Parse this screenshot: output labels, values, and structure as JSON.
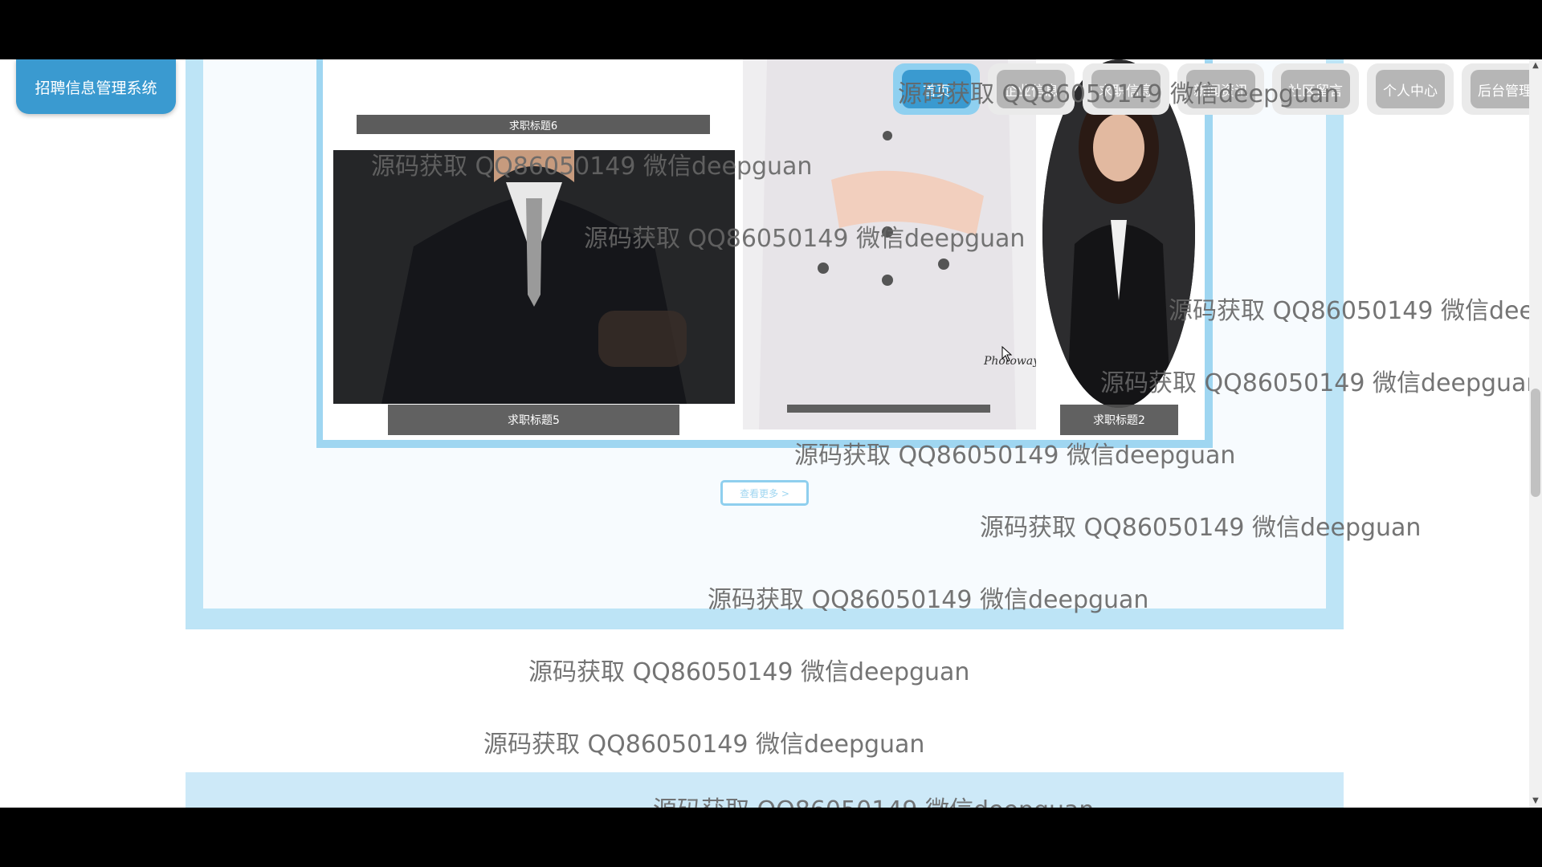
{
  "brand": {
    "title": "招聘信息管理系统"
  },
  "nav": {
    "items": [
      {
        "label": "首页",
        "active": true
      },
      {
        "label": "企业信息"
      },
      {
        "label": "求职信息"
      },
      {
        "label": "新闻资讯"
      },
      {
        "label": "社区留言"
      },
      {
        "label": "个人中心"
      },
      {
        "label": "后台管理"
      }
    ]
  },
  "cards": {
    "tag6": "求职标题6",
    "tag5": "求职标题5",
    "tag2": "求职标题2",
    "photo_caption": "Photoway"
  },
  "more_button": "查看更多 >",
  "watermark": "源码获取 QQ86050149 微信deepguan",
  "colors": {
    "accent": "#3a9ad0",
    "frame": "#9fd6f1",
    "section": "#bde4f6"
  }
}
